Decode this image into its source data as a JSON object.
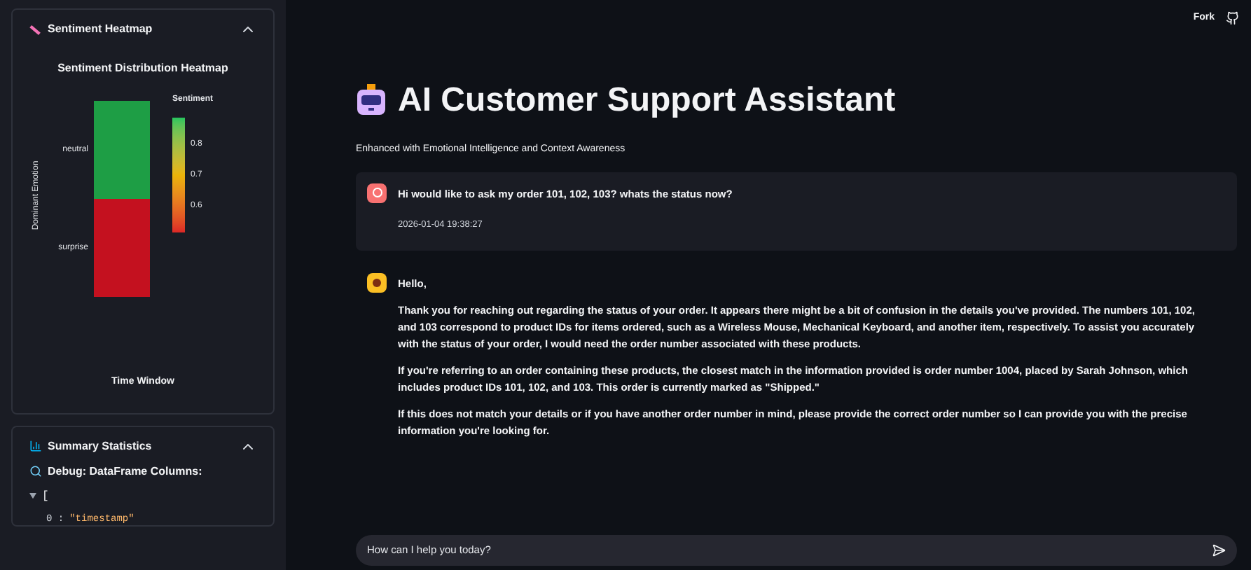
{
  "sidebar": {
    "heatmap_panel": {
      "title": "Sentiment Heatmap",
      "expanded": true,
      "chart_title": "Sentiment Distribution Heatmap",
      "ylabel": "Dominant Emotion",
      "xlabel": "Time Window",
      "legend_title": "Sentiment",
      "legend_ticks": [
        "0.8",
        "0.7",
        "0.6"
      ],
      "cells": [
        {
          "label": "neutral",
          "color": "#1e9e45"
        },
        {
          "label": "surprise",
          "color": "#c4111f"
        }
      ]
    },
    "summary_panel": {
      "title": "Summary Statistics",
      "expanded": true,
      "debug_title": "Debug: DataFrame Columns:",
      "json_open": "[",
      "json_rows": [
        {
          "index": "0 :",
          "value": "\"timestamp\""
        }
      ]
    }
  },
  "header": {
    "fork_label": "Fork"
  },
  "title": "AI Customer Support Assistant",
  "subtitle": "Enhanced with Emotional Intelligence and Context Awareness",
  "messages": [
    {
      "kind": "user",
      "paragraphs": [
        "Hi would like to ask my order 101, 102, 103? whats the status now?"
      ],
      "time": "2026-01-04 19:38:27"
    },
    {
      "kind": "assistant",
      "paragraphs": [
        "Hello,",
        "Thank you for reaching out regarding the status of your order. It appears there might be a bit of confusion in the details you've provided. The numbers 101, 102, and 103 correspond to product IDs for items ordered, such as a Wireless Mouse, Mechanical Keyboard, and another item, respectively. To assist you accurately with the status of your order, I would need the order number associated with these products.",
        "If you're referring to an order containing these products, the closest match in the information provided is order number 1004, placed by Sarah Johnson, which includes product IDs 101, 102, and 103. This order is currently marked as \"Shipped.\"",
        "If this does not match your details or if you have another order number in mind, please provide the correct order number so I can provide you with the precise information you're looking for."
      ]
    }
  ],
  "chat_input": {
    "placeholder": "How can I help you today?"
  }
}
